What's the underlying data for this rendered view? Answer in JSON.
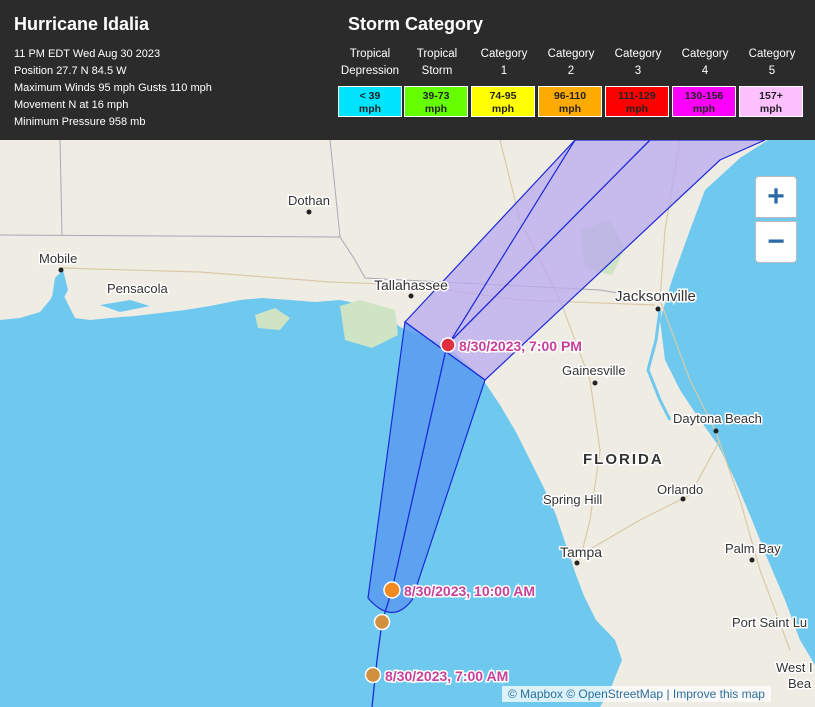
{
  "storm": {
    "name": "Hurricane Idalia",
    "lines": [
      "11 PM EDT Wed Aug 30 2023",
      "Position 27.7 N 84.5 W",
      "Maximum Winds 95 mph Gusts 110 mph",
      "Movement N at 16 mph",
      "Minimum Pressure 958 mb"
    ]
  },
  "legend": {
    "title": "Storm Category",
    "categories": [
      {
        "line1": "Tropical",
        "line2": "Depression",
        "range": "< 39",
        "unit": "mph",
        "color": "#00e5ff"
      },
      {
        "line1": "Tropical",
        "line2": "Storm",
        "range": "39-73",
        "unit": "mph",
        "color": "#66ff00"
      },
      {
        "line1": "Category",
        "line2": "1",
        "range": "74-95",
        "unit": "mph",
        "color": "#ffff00"
      },
      {
        "line1": "Category",
        "line2": "2",
        "range": "96-110",
        "unit": "mph",
        "color": "#ffaa00"
      },
      {
        "line1": "Category",
        "line2": "3",
        "range": "111-129",
        "unit": "mph",
        "color": "#ff0000"
      },
      {
        "line1": "Category",
        "line2": "4",
        "range": "130-156",
        "unit": "mph",
        "color": "#ff00ff"
      },
      {
        "line1": "Category",
        "line2": "5",
        "range": "157+",
        "unit": "mph",
        "color": "#ffc0ff"
      }
    ]
  },
  "map": {
    "places": {
      "dothan": "Dothan",
      "mobile": "Mobile",
      "pensacola": "Pensacola",
      "tallahassee": "Tallahassee",
      "jacksonville": "Jacksonville",
      "gainesville": "Gainesville",
      "daytona": "Daytona Beach",
      "florida": "FLORIDA",
      "spring_hill": "Spring Hill",
      "orlando": "Orlando",
      "tampa": "Tampa",
      "palm_bay": "Palm Bay",
      "port_saint_lucie": "Port Saint Lu",
      "west_palm": "West I",
      "west_palm2": "Bea"
    },
    "track_points": [
      {
        "label": "8/30/2023, 7:00 PM",
        "color": "#e03040"
      },
      {
        "label": "8/30/2023, 10:00 AM",
        "color": "#f08a20"
      },
      {
        "label": "",
        "color": "#d09040"
      },
      {
        "label": "8/30/2023, 7:00 AM",
        "color": "#d09040"
      }
    ],
    "zoom_in": "+",
    "zoom_out": "−",
    "attribution": {
      "mapbox": "© Mapbox",
      "osm": "© OpenStreetMap",
      "sep": "|",
      "improve": "Improve this map"
    }
  }
}
